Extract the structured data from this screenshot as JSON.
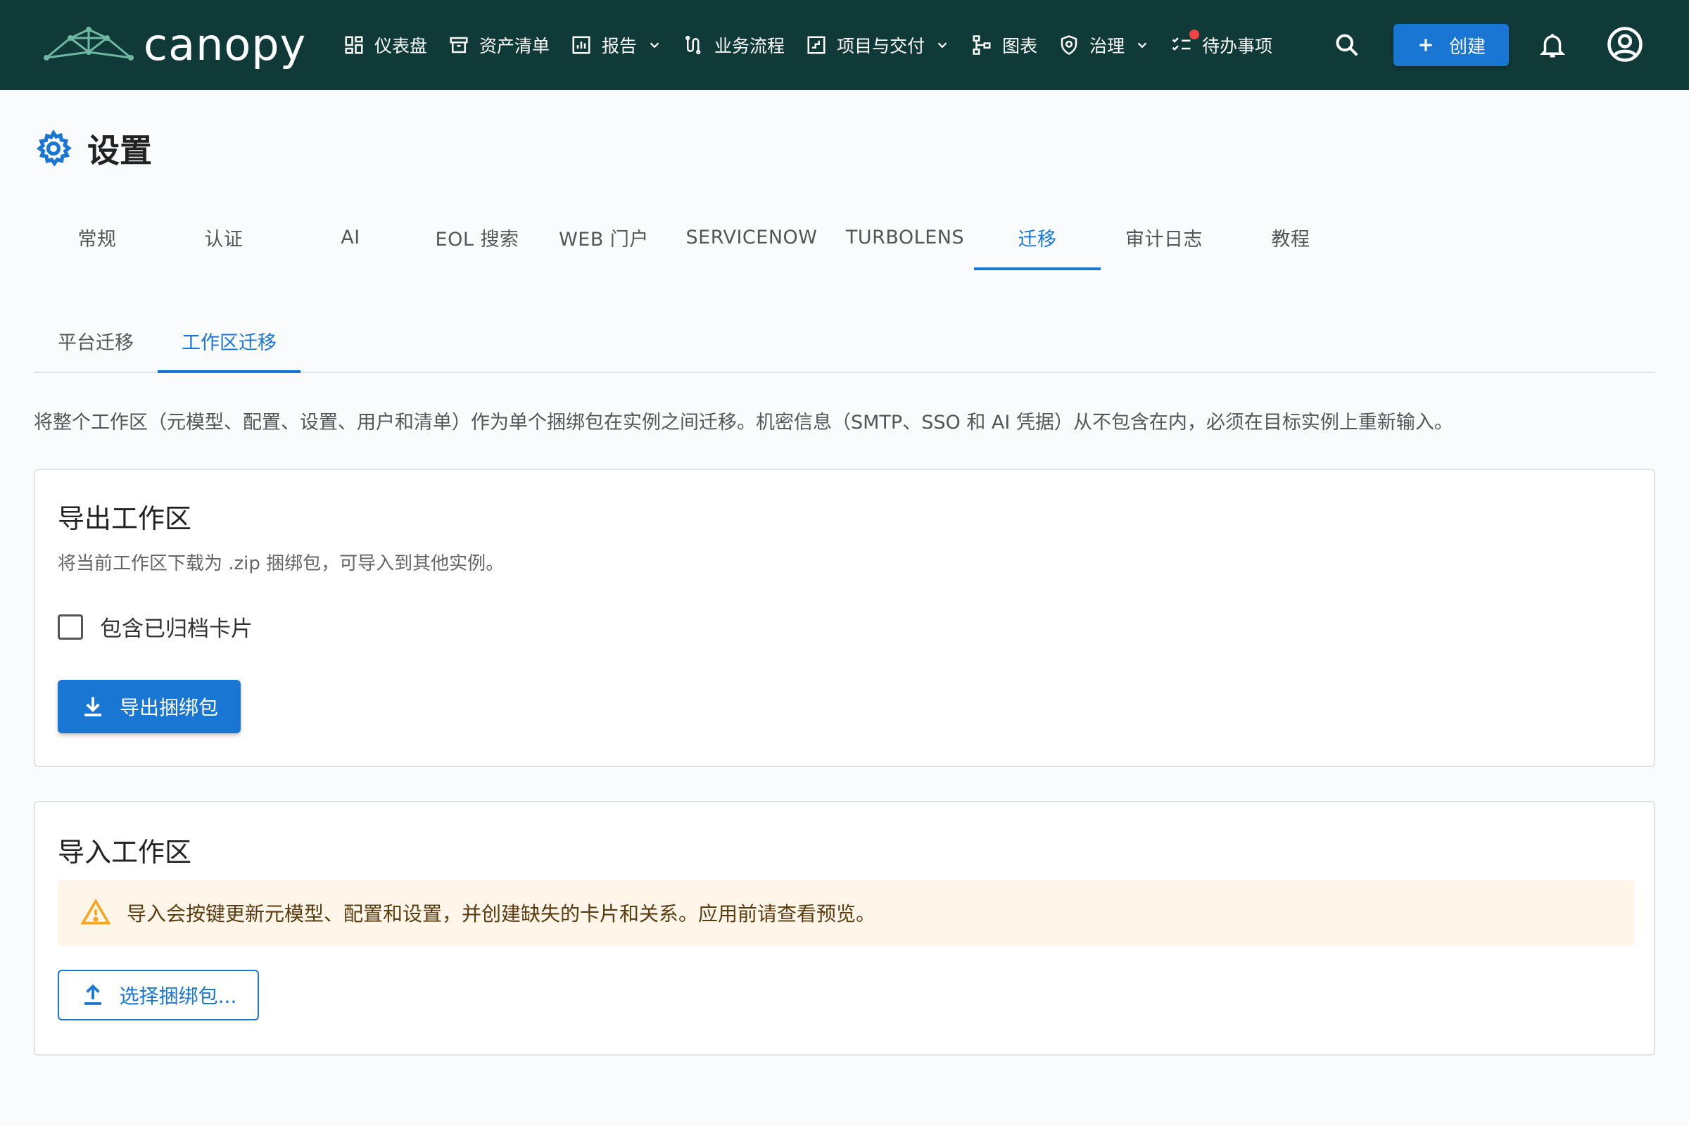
{
  "app": {
    "brand_name": "canopy"
  },
  "nav": {
    "items": [
      {
        "label": "仪表盘",
        "icon": "dashboard-icon"
      },
      {
        "label": "资产清单",
        "icon": "inventory-icon"
      },
      {
        "label": "报告",
        "icon": "reports-icon",
        "has_dropdown": true
      },
      {
        "label": "业务流程",
        "icon": "workflow-icon"
      },
      {
        "label": "项目与交付",
        "icon": "project-icon",
        "has_dropdown": true
      },
      {
        "label": "图表",
        "icon": "diagram-icon"
      },
      {
        "label": "治理",
        "icon": "governance-shield-icon",
        "has_dropdown": true
      },
      {
        "label": "待办事项",
        "icon": "todo-checklist-icon",
        "has_badge": true
      }
    ],
    "create_label": "创建"
  },
  "page": {
    "title": "设置"
  },
  "tabs": [
    {
      "label": "常规"
    },
    {
      "label": "认证"
    },
    {
      "label": "AI"
    },
    {
      "label": "EOL 搜索"
    },
    {
      "label": "WEB 门户"
    },
    {
      "label": "SERVICENOW"
    },
    {
      "label": "TURBOLENS"
    },
    {
      "label": "迁移",
      "active": true
    },
    {
      "label": "审计日志"
    },
    {
      "label": "教程"
    }
  ],
  "subtabs": [
    {
      "label": "平台迁移"
    },
    {
      "label": "工作区迁移",
      "active": true
    }
  ],
  "description": "将整个工作区（元模型、配置、设置、用户和清单）作为单个捆绑包在实例之间迁移。机密信息（SMTP、SSO 和 AI 凭据）从不包含在内，必须在目标实例上重新输入。",
  "export": {
    "title": "导出工作区",
    "subtitle": "将当前工作区下载为 .zip 捆绑包，可导入到其他实例。",
    "checkbox_label": "包含已归档卡片",
    "checkbox_checked": false,
    "button_label": "导出捆绑包"
  },
  "import": {
    "title": "导入工作区",
    "warning": "导入会按键更新元模型、配置和设置，并创建缺失的卡片和关系。应用前请查看预览。",
    "button_label": "选择捆绑包..."
  },
  "colors": {
    "topbar": "#0f3a37",
    "accent": "#1976d2",
    "warning_bg": "#fff5e8",
    "warning_icon": "#f5a623",
    "badge": "#ef4444"
  }
}
